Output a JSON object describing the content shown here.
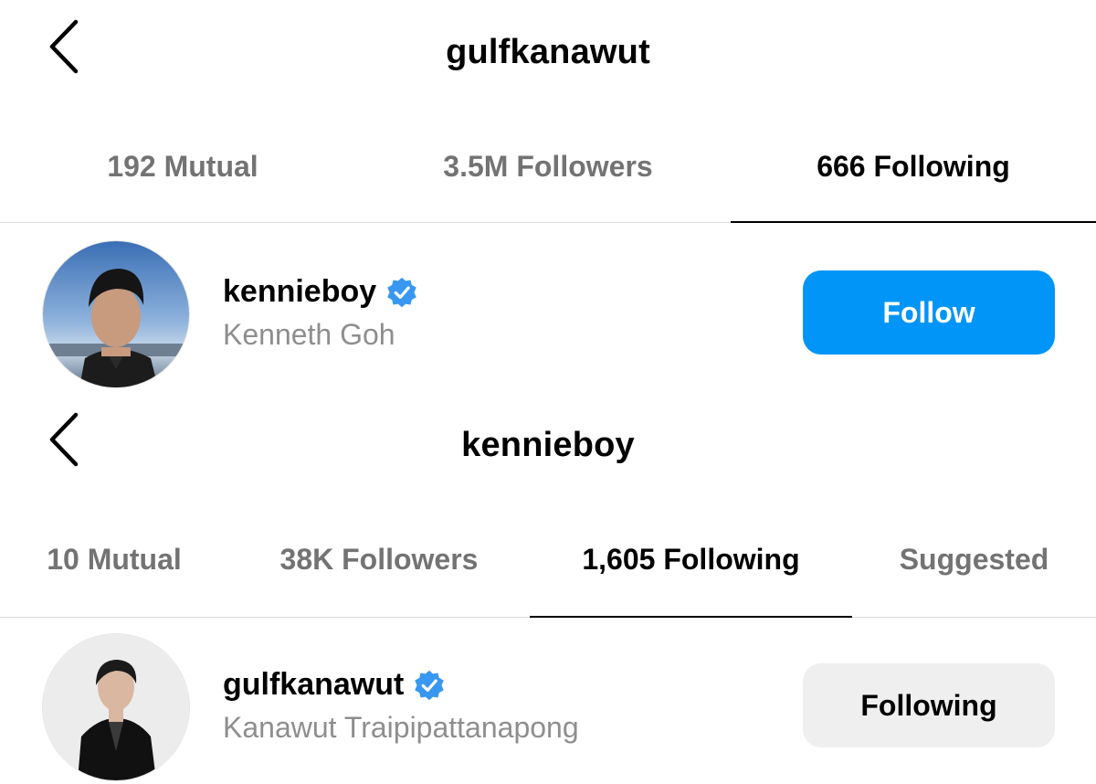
{
  "colors": {
    "accent_blue": "#0095f6",
    "muted_text": "#8e8e8e",
    "inactive_tab": "#737373",
    "secondary_button": "#efefef",
    "divider": "#dbdbdb"
  },
  "panel_1": {
    "back_icon": "chevron-left-icon",
    "title": "gulfkanawut",
    "tabs": [
      {
        "label": "192 Mutual",
        "active": false
      },
      {
        "label": "3.5M Followers",
        "active": false
      },
      {
        "label": "666 Following",
        "active": true
      }
    ],
    "row": {
      "username": "kennieboy",
      "verified": true,
      "full_name": "Kenneth Goh",
      "button_label": "Follow"
    }
  },
  "panel_2": {
    "back_icon": "chevron-left-icon",
    "title": "kennieboy",
    "tabs": [
      {
        "label": "10 Mutual",
        "active": false
      },
      {
        "label": "38K Followers",
        "active": false
      },
      {
        "label": "1,605 Following",
        "active": true
      },
      {
        "label": "Suggested",
        "active": false
      }
    ],
    "row": {
      "username": "gulfkanawut",
      "verified": true,
      "full_name": "Kanawut Traipipattanapong",
      "button_label": "Following"
    }
  }
}
